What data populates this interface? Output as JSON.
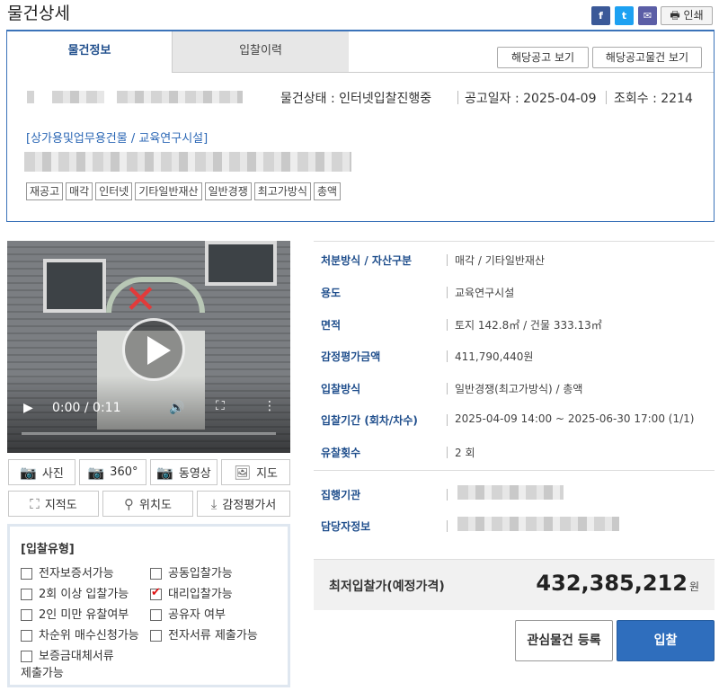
{
  "page": {
    "title": "물건상세"
  },
  "share": {
    "facebook": "f",
    "twitter": "t",
    "mail": "✉",
    "print_label": "인쇄",
    "print_icon": "printer-icon"
  },
  "tabs": [
    {
      "label": "물건정보",
      "active": true
    },
    {
      "label": "입찰이력",
      "active": false
    }
  ],
  "header_buttons": {
    "notice": "해당공고 보기",
    "notice_items": "해당공고물건 보기"
  },
  "status": {
    "text": "물건상태 : 인터넷입찰진행중",
    "announce_date": "공고일자 : 2025-04-09",
    "views": "조회수 : 2214"
  },
  "category": "[상가용및업무용건물 / 교육연구시설]",
  "tags": [
    "재공고",
    "매각",
    "인터넷",
    "기타일반재산",
    "일반경쟁",
    "최고가방식",
    "총액"
  ],
  "video": {
    "time": "0:00 / 0:11",
    "progress": 0
  },
  "media_buttons": {
    "photo": "사진",
    "view360": "360°",
    "video": "동영상",
    "map": "지도",
    "cadastral": "지적도",
    "location": "위치도",
    "appraisal": "감정평가서"
  },
  "bid_types": {
    "title": "[입찰유형]",
    "items": [
      {
        "label": "전자보증서가능",
        "checked": false
      },
      {
        "label": "공동입찰가능",
        "checked": false
      },
      {
        "label": "2회 이상 입찰가능",
        "checked": false
      },
      {
        "label": "대리입찰가능",
        "checked": true
      },
      {
        "label": "2인 미만 유찰여부",
        "checked": false
      },
      {
        "label": "공유자 여부",
        "checked": false
      },
      {
        "label": "차순위 매수신청가능",
        "checked": false
      },
      {
        "label": "전자서류 제출가능",
        "checked": false
      },
      {
        "label": "보증금대체서류",
        "label2": "제출가능",
        "checked": false
      }
    ]
  },
  "details": [
    {
      "key": "처분방식 / 자산구분",
      "value": "매각 / 기타일반재산"
    },
    {
      "key": "용도",
      "value": "교육연구시설"
    },
    {
      "key": "면적",
      "value": "토지 142.8㎡ / 건물 333.13㎡"
    },
    {
      "key": "감정평가금액",
      "value": "411,790,440원"
    },
    {
      "key": "입찰방식",
      "value": "일반경쟁(최고가방식) / 총액"
    },
    {
      "key": "입찰기간 (회차/차수)",
      "value": "2025-04-09 14:00 ~ 2025-06-30 17:00 (1/1)"
    },
    {
      "key": "유찰횟수",
      "value": "2 회"
    },
    {
      "key": "집행기관",
      "value": ""
    },
    {
      "key": "담당자정보",
      "value": ""
    }
  ],
  "price": {
    "label": "최저입찰가(예정가격)",
    "value": "432,385,212",
    "unit": "원"
  },
  "actions": {
    "favorite": "관심물건 등록",
    "bid": "입찰"
  },
  "colors": {
    "accent": "#2f6ebd",
    "label": "#1f4e8c",
    "category": "#2b67b5",
    "check": "#dd1111"
  }
}
